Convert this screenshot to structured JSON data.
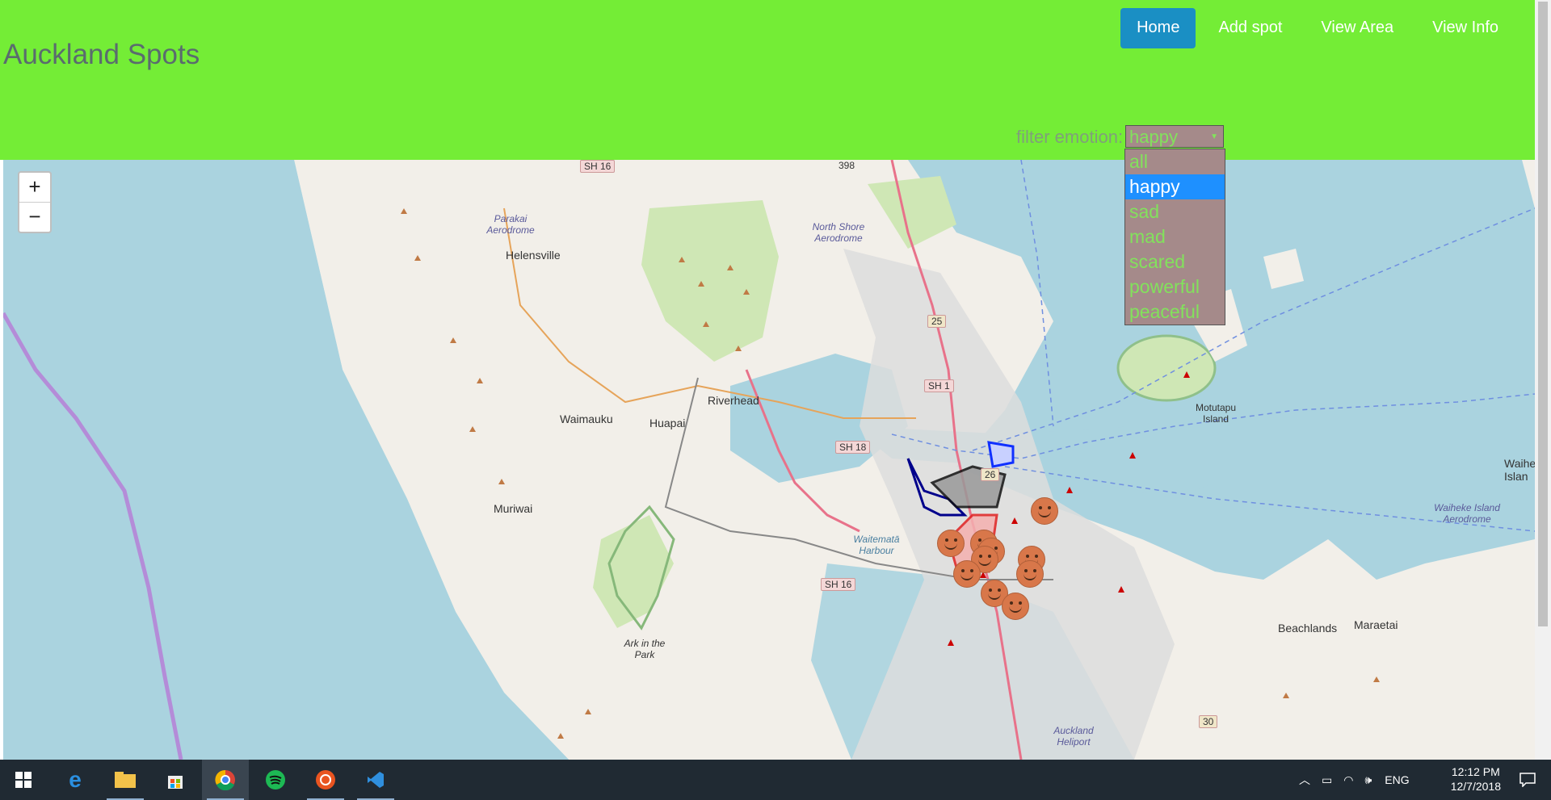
{
  "header": {
    "title": "Auckland Spots",
    "nav": [
      {
        "label": "Home",
        "active": true
      },
      {
        "label": "Add spot"
      },
      {
        "label": "View Area"
      },
      {
        "label": "View Info"
      }
    ],
    "filter_label": "filter emotion:",
    "filter_selected": "happy",
    "filter_options": [
      "all",
      "happy",
      "sad",
      "mad",
      "scared",
      "powerful",
      "peaceful"
    ]
  },
  "map": {
    "zoom_in": "+",
    "zoom_out": "−",
    "labels": {
      "helensville": "Helensville",
      "riverhead": "Riverhead",
      "waimauku": "Waimauku",
      "huapai": "Huapai",
      "muriwai": "Muriwai",
      "parakai": "Parakai Aerodrome",
      "north_shore": "North Shore Aerodrome",
      "waitemata": "Waitematā Harbour",
      "ark": "Ark in the Park",
      "motutapu": "Motutapu Island",
      "waiheke_aero": "Waiheke Island Aerodrome",
      "waiheke": "Waihe Islan",
      "beachlands": "Beachlands",
      "maraetai": "Maraetai",
      "heliport": "Auckland Heliport"
    },
    "shields": [
      "SH 16",
      "SH 1",
      "SH 18",
      "SH 16",
      "25",
      "26",
      "30",
      "398"
    ]
  },
  "taskbar": {
    "lang": "ENG",
    "time": "12:12 PM",
    "date": "12/7/2018"
  }
}
